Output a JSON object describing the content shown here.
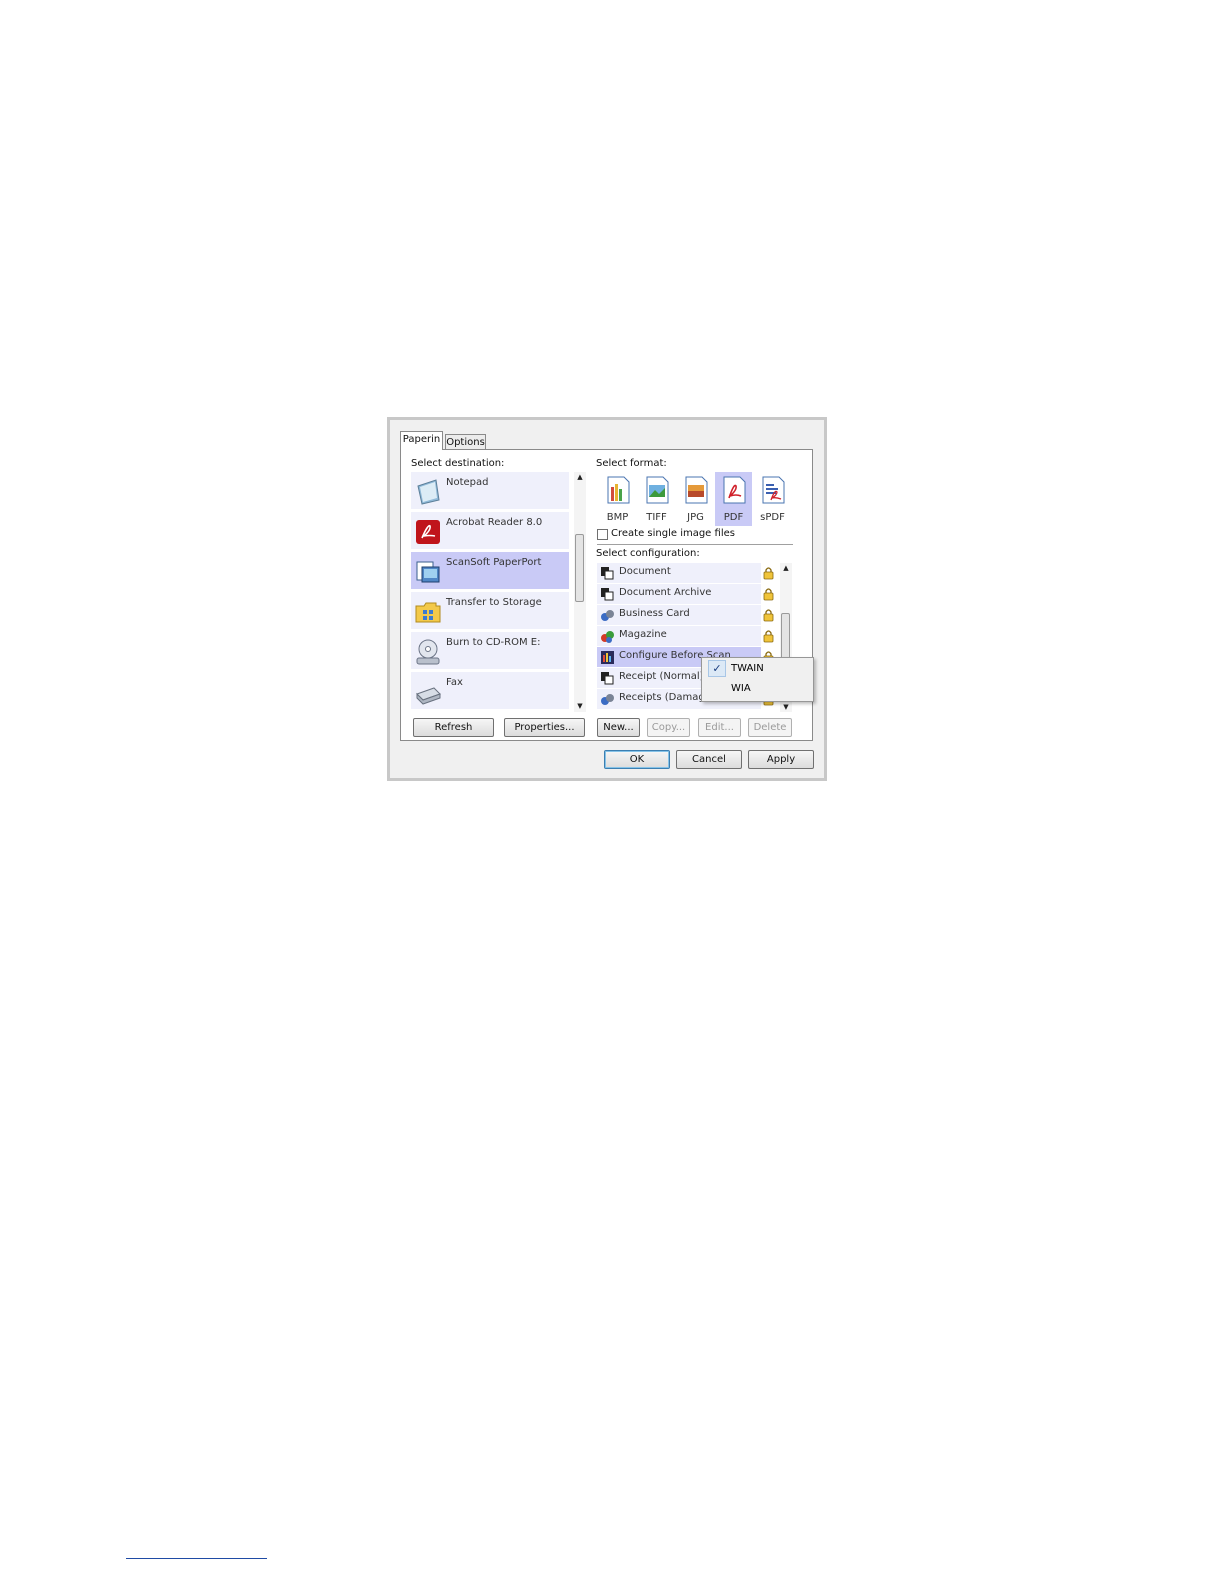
{
  "tabs": [
    {
      "label": "Paperin",
      "active": true
    },
    {
      "label": "Options",
      "active": false
    }
  ],
  "destination": {
    "label": "Select destination:",
    "items": [
      {
        "label": "Notepad",
        "icon": "notepad-icon"
      },
      {
        "label": "Acrobat Reader 8.0",
        "icon": "acrobat-icon"
      },
      {
        "label": "ScanSoft PaperPort",
        "icon": "paperport-icon",
        "selected": true
      },
      {
        "label": "Transfer to Storage",
        "icon": "folder-icon"
      },
      {
        "label": "Burn to CD-ROM  E:",
        "icon": "cd-burn-icon"
      },
      {
        "label": "Fax",
        "icon": "fax-icon"
      }
    ]
  },
  "format": {
    "label": "Select format:",
    "items": [
      {
        "label": "BMP",
        "icon": "bmp-icon"
      },
      {
        "label": "TIFF",
        "icon": "tiff-icon"
      },
      {
        "label": "JPG",
        "icon": "jpg-icon"
      },
      {
        "label": "PDF",
        "icon": "pdf-icon",
        "selected": true
      },
      {
        "label": "sPDF",
        "icon": "spdf-icon"
      }
    ],
    "single_image_checkbox": {
      "label": "Create single image files",
      "checked": false
    }
  },
  "configuration": {
    "label": "Select configuration:",
    "items": [
      {
        "label": "Document",
        "icon": "document-config-icon",
        "locked": true
      },
      {
        "label": "Document Archive",
        "icon": "document-config-icon",
        "locked": true
      },
      {
        "label": "Business Card",
        "icon": "color-config-icon",
        "locked": true
      },
      {
        "label": "Magazine",
        "icon": "color-config-icon",
        "locked": true
      },
      {
        "label": "Configure Before Scan",
        "icon": "configure-icon",
        "locked": true,
        "selected": true
      },
      {
        "label": "Receipt (Normal)",
        "icon": "document-config-icon",
        "locked": true
      },
      {
        "label": "Receipts (Damaged)",
        "icon": "color-config-icon",
        "locked": true
      }
    ]
  },
  "buttons": {
    "refresh": "Refresh",
    "properties": "Properties...",
    "new": "New...",
    "copy": "Copy...",
    "edit": "Edit...",
    "delete": "Delete",
    "ok": "OK",
    "cancel": "Cancel",
    "apply": "Apply"
  },
  "context_menu": {
    "items": [
      {
        "label": "TWAIN",
        "checked": true
      },
      {
        "label": "WIA",
        "checked": false
      }
    ]
  },
  "colors": {
    "selection": "#c9caf6",
    "item_background": "#eff0fb",
    "dialog_background": "#f0f0f0"
  }
}
